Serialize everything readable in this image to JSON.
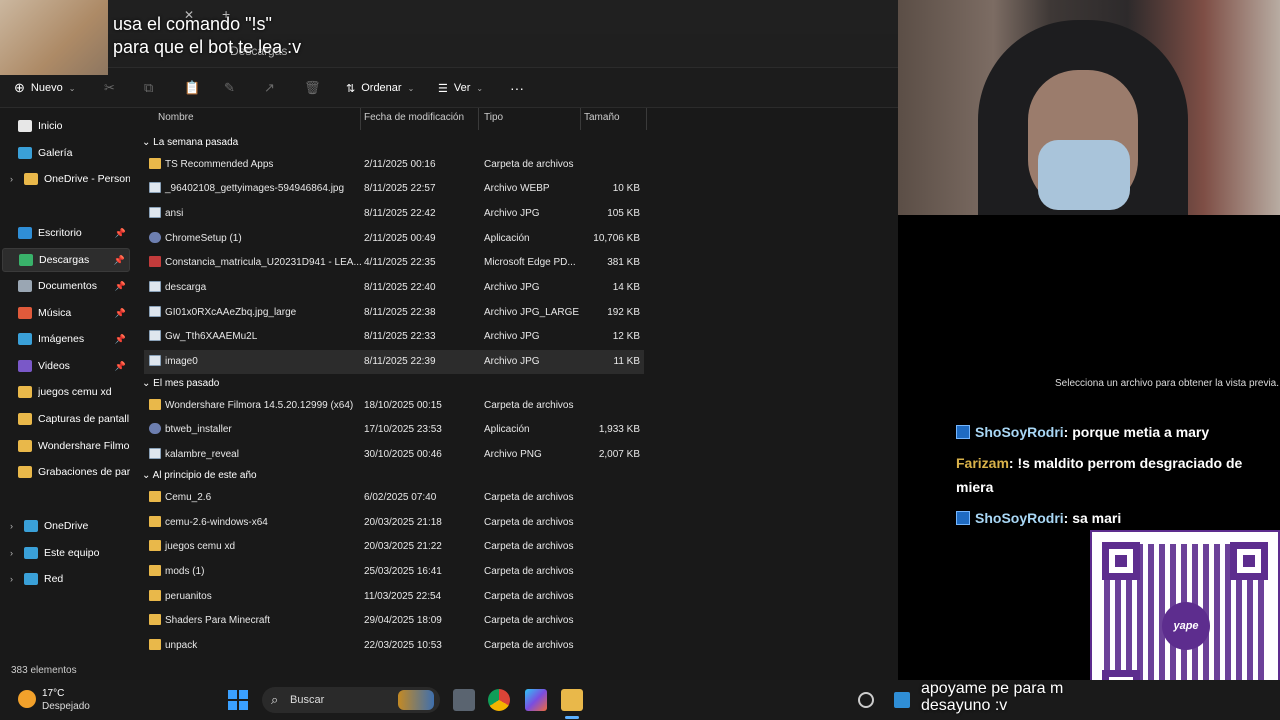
{
  "overlay": {
    "line1": "usa el comando \"!s\"",
    "line2": "para que el bot te lea :v",
    "bottom_line1": "apoyame pe para m",
    "bottom_line2": "desayuno :v"
  },
  "explorer": {
    "tab_title": "Descargas",
    "toolbar": {
      "new_label": "Nuevo",
      "sort_label": "Ordenar",
      "view_label": "Ver",
      "more_label": "···"
    },
    "sidebar": {
      "items": [
        {
          "label": "Inicio",
          "color": "#e7e7e7"
        },
        {
          "label": "Galería",
          "color": "#3aa0d8"
        },
        {
          "label": "OneDrive - Persona",
          "color": "#e9b84a"
        },
        {
          "label": "Escritorio",
          "color": "#2f8ed6"
        },
        {
          "label": "Descargas",
          "color": "#39b26a"
        },
        {
          "label": "Documentos",
          "color": "#9aa6b3"
        },
        {
          "label": "Música",
          "color": "#e05a3b"
        },
        {
          "label": "Imágenes",
          "color": "#3aa0d8"
        },
        {
          "label": "Videos",
          "color": "#7a58c8"
        },
        {
          "label": "juegos cemu xd",
          "color": "#e9b84a"
        },
        {
          "label": "Capturas de pantall",
          "color": "#e9b84a"
        },
        {
          "label": "Wondershare Filmo",
          "color": "#e9b84a"
        },
        {
          "label": "Grabaciones de par",
          "color": "#e9b84a"
        },
        {
          "label": "OneDrive",
          "color": "#3aa0d8"
        },
        {
          "label": "Este equipo",
          "color": "#3aa0d8"
        },
        {
          "label": "Red",
          "color": "#3aa0d8"
        }
      ]
    },
    "columns": {
      "name": "Nombre",
      "date": "Fecha de modificación",
      "type": "Tipo",
      "size": "Tamaño"
    },
    "groups": [
      {
        "label": "La semana pasada",
        "rows": [
          {
            "name": "TS Recommended Apps",
            "date": "2/11/2025 00:16",
            "type": "Carpeta de archivos",
            "size": "",
            "icon": "folder"
          },
          {
            "name": "_96402108_gettyimages-594946864.jpg",
            "date": "8/11/2025 22:57",
            "type": "Archivo WEBP",
            "size": "10 KB",
            "icon": "file"
          },
          {
            "name": "ansi",
            "date": "8/11/2025 22:42",
            "type": "Archivo JPG",
            "size": "105 KB",
            "icon": "file"
          },
          {
            "name": "ChromeSetup (1)",
            "date": "2/11/2025 00:49",
            "type": "Aplicación",
            "size": "10,706 KB",
            "icon": "app"
          },
          {
            "name": "Constancia_matricula_U20231D941 - LEA...",
            "date": "4/11/2025 22:35",
            "type": "Microsoft Edge PD...",
            "size": "381 KB",
            "icon": "pdf"
          },
          {
            "name": "descarga",
            "date": "8/11/2025 22:40",
            "type": "Archivo JPG",
            "size": "14 KB",
            "icon": "file"
          },
          {
            "name": "GI01x0RXcAAeZbq.jpg_large",
            "date": "8/11/2025 22:38",
            "type": "Archivo JPG_LARGE",
            "size": "192 KB",
            "icon": "file"
          },
          {
            "name": "Gw_Tth6XAAEMu2L",
            "date": "8/11/2025 22:33",
            "type": "Archivo JPG",
            "size": "12 KB",
            "icon": "file"
          },
          {
            "name": "image0",
            "date": "8/11/2025 22:39",
            "type": "Archivo JPG",
            "size": "11 KB",
            "icon": "file"
          }
        ]
      },
      {
        "label": "El mes pasado",
        "rows": [
          {
            "name": "Wondershare Filmora 14.5.20.12999 (x64)",
            "date": "18/10/2025 00:15",
            "type": "Carpeta de archivos",
            "size": "",
            "icon": "folder"
          },
          {
            "name": "btweb_installer",
            "date": "17/10/2025 23:53",
            "type": "Aplicación",
            "size": "1,933 KB",
            "icon": "app"
          },
          {
            "name": "kalambre_reveal",
            "date": "30/10/2025 00:46",
            "type": "Archivo PNG",
            "size": "2,007 KB",
            "icon": "file"
          }
        ]
      },
      {
        "label": "Al principio de este año",
        "rows": [
          {
            "name": "Cemu_2.6",
            "date": "6/02/2025 07:40",
            "type": "Carpeta de archivos",
            "size": "",
            "icon": "folder"
          },
          {
            "name": "cemu-2.6-windows-x64",
            "date": "20/03/2025 21:18",
            "type": "Carpeta de archivos",
            "size": "",
            "icon": "folder"
          },
          {
            "name": "juegos cemu xd",
            "date": "20/03/2025 21:22",
            "type": "Carpeta de archivos",
            "size": "",
            "icon": "folder"
          },
          {
            "name": "mods (1)",
            "date": "25/03/2025 16:41",
            "type": "Carpeta de archivos",
            "size": "",
            "icon": "folder"
          },
          {
            "name": "peruanitos",
            "date": "11/03/2025 22:54",
            "type": "Carpeta de archivos",
            "size": "",
            "icon": "folder"
          },
          {
            "name": "Shaders Para Minecraft",
            "date": "29/04/2025 18:09",
            "type": "Carpeta de archivos",
            "size": "",
            "icon": "folder"
          },
          {
            "name": "unpack",
            "date": "22/03/2025 10:53",
            "type": "Carpeta de archivos",
            "size": "",
            "icon": "folder"
          }
        ]
      }
    ],
    "preview_message": "Selecciona un archivo para obtener la vista previa.",
    "status_count": "383 elementos"
  },
  "chat": [
    {
      "user": "ShoSoyRodri",
      "message": ": porque metia a mary",
      "badge": true
    },
    {
      "user": "Farizam",
      "message": ": !s maldito perrom desgraciado de miera",
      "badge": false
    },
    {
      "user": "ShoSoyRodri",
      "message": ": sa mari",
      "badge": true
    }
  ],
  "qr": {
    "brand": "yape"
  },
  "taskbar": {
    "temperature": "17°C",
    "weather": "Despejado",
    "search_label": "Buscar"
  }
}
